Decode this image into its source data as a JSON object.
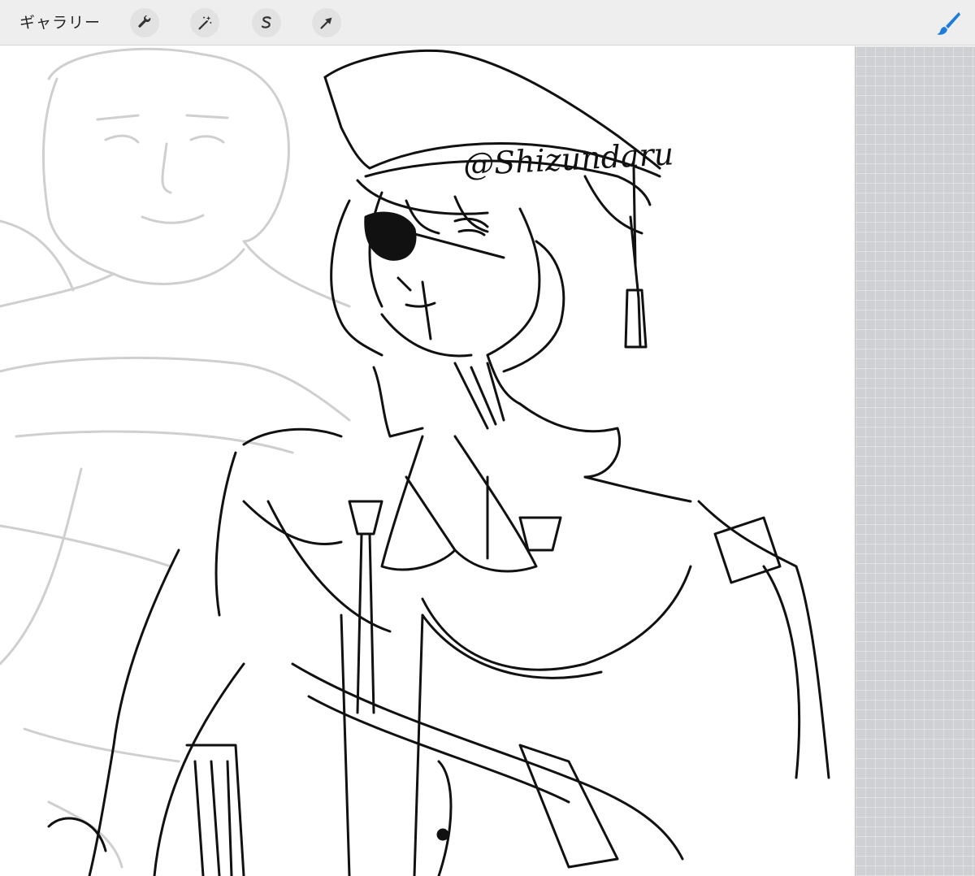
{
  "toolbar": {
    "gallery_label": "ギャラリー",
    "tools": [
      {
        "name": "actions",
        "icon": "wrench-icon"
      },
      {
        "name": "adjustments",
        "icon": "magic-wand-icon"
      },
      {
        "name": "selection",
        "icon": "selection-s-icon"
      },
      {
        "name": "transform",
        "icon": "arrow-cursor-icon"
      }
    ],
    "brush_icon": "brush-icon"
  },
  "canvas": {
    "signature_text": "@Shizundaru",
    "reference_layer_color": "#cfcfcf",
    "ink_color": "#111111"
  },
  "colors": {
    "toolbar_bg": "#eeeeee",
    "accent_blue": "#1f7bdc",
    "grid_bg": "#cfd0d4"
  }
}
